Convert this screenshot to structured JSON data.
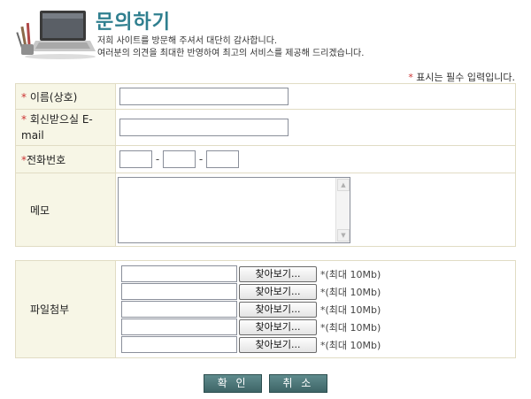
{
  "header": {
    "title": "문의하기",
    "description_line1": "저희 사이트를 방문해 주셔서 대단히 감사합니다.",
    "description_line2": "여러분의 의견을 최대한 반영하여 최고의 서비스를 제공해 드리겠습니다."
  },
  "required_note": {
    "star": "*",
    "text": " 표시는 필수 입력입니다."
  },
  "form": {
    "name_label": "이름(상호)",
    "email_label": "회신받으실 E-mail",
    "phone_label": "전화번호",
    "phone_dash": "-",
    "memo_label": "메모",
    "name_value": "",
    "email_value": "",
    "phone_part1": "",
    "phone_part2": "",
    "phone_part3": "",
    "memo_value": "",
    "required_star": "*"
  },
  "files": {
    "label": "파일첨부",
    "browse_label": "찾아보기...",
    "size_note": "*(최대 10Mb)",
    "count": 5
  },
  "buttons": {
    "confirm": "확 인",
    "cancel": "취 소"
  },
  "colors": {
    "title": "#2f7f8f",
    "required_star": "#cc3333",
    "label_background": "#f7f6e6",
    "border": "#e1dcc4",
    "action_button": "#4e7779"
  }
}
